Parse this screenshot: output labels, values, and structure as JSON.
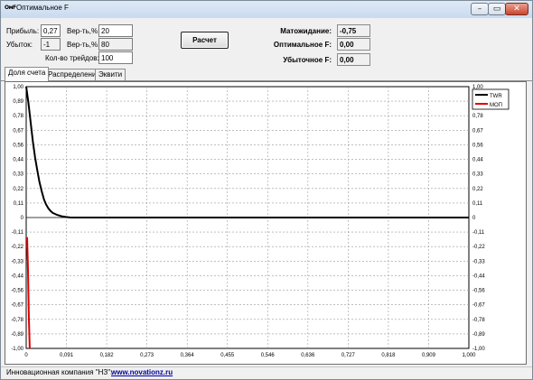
{
  "window": {
    "icon_text": "ОмF",
    "title": "Оптимальное F",
    "minimize_glyph": "–",
    "maximize_glyph": "▭",
    "close_glyph": "✕"
  },
  "inputs": {
    "profit_label": "Прибыль:",
    "profit_value": "0,27",
    "loss_label": "Убыток:",
    "loss_value": "-1",
    "prob1_label": "Вер-ть,%:",
    "prob1_value": "20",
    "prob2_label": "Вер-ть,%:",
    "prob2_value": "80",
    "trades_label": "Кол-во трейдов:",
    "trades_value": "100"
  },
  "calc_button": "Расчет",
  "results": {
    "expectation_label": "Матожидание:",
    "expectation_value": "-0,75",
    "optimal_f_label": "Оптимальное F:",
    "optimal_f_value": "0,00",
    "loss_f_label": "Убыточное F:",
    "loss_f_value": "0,00"
  },
  "tabs": [
    "Доля счета",
    "Распределение",
    "Эквити"
  ],
  "active_tab": 0,
  "chart_data": {
    "type": "line",
    "xlim": [
      0,
      1
    ],
    "ylim": [
      -1,
      1
    ],
    "x_ticks": [
      "0",
      "0,091",
      "0,182",
      "0,273",
      "0,364",
      "0,455",
      "0,546",
      "0,636",
      "0,727",
      "0,818",
      "0,909",
      "1,000"
    ],
    "y_ticks": [
      "1,00",
      "0,89",
      "0,78",
      "0,67",
      "0,56",
      "0,44",
      "0,33",
      "0,22",
      "0,11",
      "0",
      "-0,11",
      "-0,22",
      "-0,33",
      "-0,44",
      "-0,56",
      "-0,67",
      "-0,78",
      "-0,89",
      "-1,00"
    ],
    "grid": true,
    "legend_position": "top-right",
    "series": [
      {
        "name": "TWR",
        "color": "#000000",
        "points": [
          [
            0,
            1.0
          ],
          [
            0.005,
            0.88
          ],
          [
            0.01,
            0.73
          ],
          [
            0.015,
            0.58
          ],
          [
            0.02,
            0.46
          ],
          [
            0.025,
            0.36
          ],
          [
            0.03,
            0.27
          ],
          [
            0.035,
            0.2
          ],
          [
            0.04,
            0.14
          ],
          [
            0.045,
            0.1
          ],
          [
            0.05,
            0.07
          ],
          [
            0.055,
            0.05
          ],
          [
            0.06,
            0.035
          ],
          [
            0.07,
            0.02
          ],
          [
            0.08,
            0.01
          ],
          [
            0.09,
            0.004
          ],
          [
            0.1,
            0.0
          ],
          [
            1.0,
            0.0
          ]
        ]
      },
      {
        "name": "МОП",
        "color": "#e00000",
        "points": [
          [
            0.002,
            -0.15
          ],
          [
            0.004,
            -0.4
          ],
          [
            0.006,
            -0.75
          ],
          [
            0.008,
            -1.0
          ]
        ]
      }
    ]
  },
  "statusbar": {
    "company": "Инновационная компания \"НЗ\":",
    "link": "www.novationz.ru"
  }
}
